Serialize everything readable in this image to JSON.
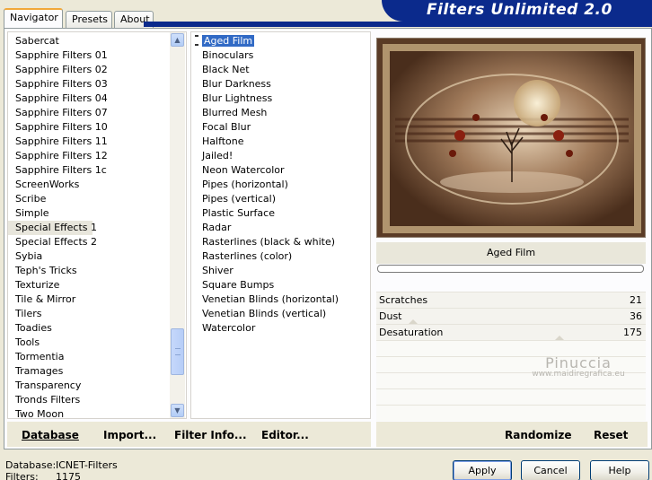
{
  "tabs": [
    {
      "label": "Navigator",
      "active": true
    },
    {
      "label": "Presets",
      "active": false
    },
    {
      "label": "About",
      "active": false
    }
  ],
  "banner": "Filters Unlimited 2.0",
  "categories": {
    "selected": "Special Effects 1",
    "items": [
      "Sabercat",
      "Sapphire Filters 01",
      "Sapphire Filters 02",
      "Sapphire Filters 03",
      "Sapphire Filters 04",
      "Sapphire Filters 07",
      "Sapphire Filters 10",
      "Sapphire Filters 11",
      "Sapphire Filters 12",
      "Sapphire Filters 1c",
      "ScreenWorks",
      "Scribe",
      "Simple",
      "Special Effects 1",
      "Special Effects 2",
      "Sybia",
      "Teph's Tricks",
      "Texturize",
      "Tile & Mirror",
      "Tilers",
      "Toadies",
      "Tools",
      "Tormentia",
      "Tramages",
      "Transparency",
      "Tronds Filters",
      "Two Moon"
    ]
  },
  "filters": {
    "selected": "Aged Film",
    "items": [
      "Aged Film",
      "Binoculars",
      "Black Net",
      "Blur Darkness",
      "Blur Lightness",
      "Blurred Mesh",
      "Focal Blur",
      "Halftone",
      "Jailed!",
      "Neon Watercolor",
      "Pipes (horizontal)",
      "Pipes (vertical)",
      "Plastic Surface",
      "Radar",
      "Rasterlines (black & white)",
      "Rasterlines (color)",
      "Shiver",
      "Square Bumps",
      "Venetian Blinds (horizontal)",
      "Venetian Blinds (vertical)",
      "Watercolor"
    ]
  },
  "preview": {
    "filter_name": "Aged Film",
    "progress": 0
  },
  "params": [
    {
      "label": "Scratches",
      "value": "21"
    },
    {
      "label": "Dust",
      "value": "36"
    },
    {
      "label": "Desaturation",
      "value": "175"
    }
  ],
  "watermark": {
    "name": "Pinuccia",
    "site": "www.maidiregrafica.eu"
  },
  "toolbar": {
    "database": "Database",
    "import": "Import...",
    "filter_info": "Filter Info...",
    "editor": "Editor...",
    "randomize": "Randomize",
    "reset": "Reset"
  },
  "footer": {
    "database_label": "Database:",
    "database_value": "ICNET-Filters",
    "filters_label": "Filters:",
    "filters_value": "1175"
  },
  "buttons": {
    "apply": "Apply",
    "cancel": "Cancel",
    "help": "Help"
  }
}
